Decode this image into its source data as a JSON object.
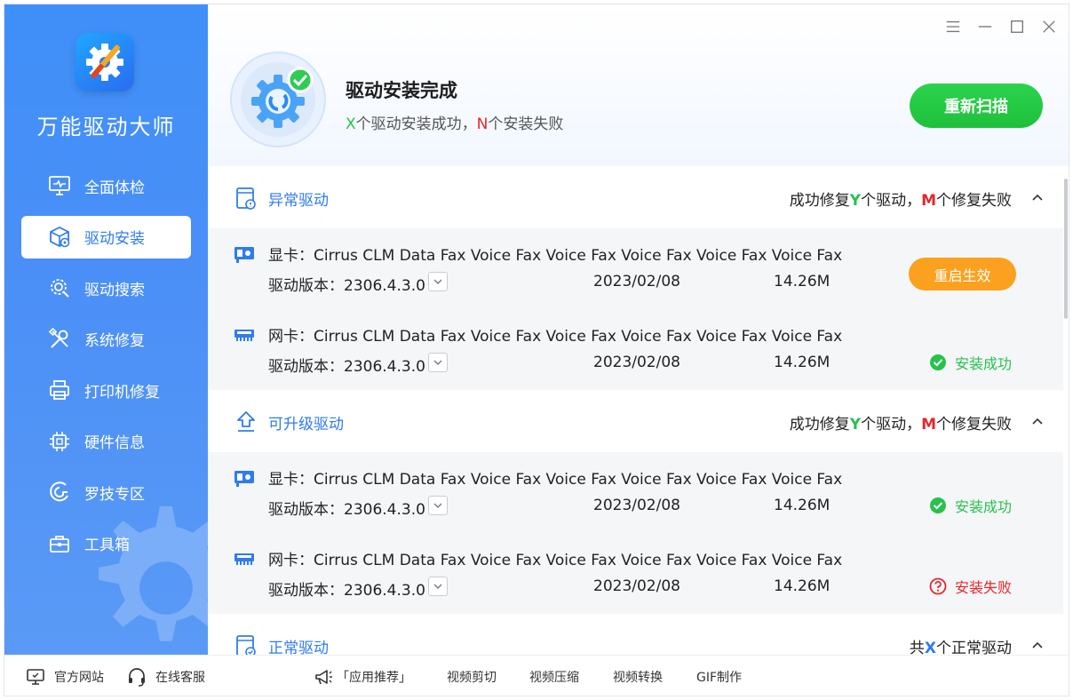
{
  "app": {
    "title": "万能驱动大师"
  },
  "sidebar": {
    "items": [
      {
        "label": "全面体检",
        "icon": "monitor-pulse-icon",
        "active": false
      },
      {
        "label": "驱动安装",
        "icon": "box-gear-icon",
        "active": true
      },
      {
        "label": "驱动搜索",
        "icon": "gear-search-icon",
        "active": false
      },
      {
        "label": "系统修复",
        "icon": "wrench-screwdriver-icon",
        "active": false
      },
      {
        "label": "打印机修复",
        "icon": "printer-icon",
        "active": false
      },
      {
        "label": "硬件信息",
        "icon": "chip-icon",
        "active": false
      },
      {
        "label": "罗技专区",
        "icon": "logitech-icon",
        "active": false
      },
      {
        "label": "工具箱",
        "icon": "toolbox-icon",
        "active": false
      }
    ]
  },
  "header": {
    "title": "驱动安装完成",
    "subtitle": {
      "x": "X",
      "part1": "个驱动安装成功，",
      "n": "N",
      "part2": "个安装失败"
    },
    "rescan_label": "重新扫描"
  },
  "sections": [
    {
      "title": "异常驱动",
      "summary": {
        "part1": "成功修复",
        "y": "Y",
        "part2": "个驱动，",
        "m": "M",
        "part3": "个修复失败"
      },
      "rows": [
        {
          "name": "显卡：Cirrus CLM Data Fax Voice Fax Voice Fax Voice Fax Voice Fax Voice Fax ...",
          "icon": "display-card-icon",
          "version": "驱动版本：2306.4.3.0",
          "date": "2023/02/08",
          "size": "14.26M",
          "status_type": "restart",
          "status_label": "重启生效"
        },
        {
          "name": "网卡：Cirrus CLM Data Fax Voice Fax Voice Fax Voice Fax Voice Fax Voice Fax ...",
          "icon": "network-card-icon",
          "version": "驱动版本：2306.4.3.0",
          "date": "2023/02/08",
          "size": "14.26M",
          "status_type": "ok",
          "status_label": "安装成功"
        }
      ]
    },
    {
      "title": "可升级驱动",
      "summary": {
        "part1": "成功修复",
        "y": "Y",
        "part2": "个驱动，",
        "m": "M",
        "part3": "个修复失败"
      },
      "rows": [
        {
          "name": "显卡：Cirrus CLM Data Fax Voice Fax Voice Fax Voice Fax Voice Fax Voice Fax ...",
          "icon": "display-card-icon",
          "version": "驱动版本：2306.4.3.0",
          "date": "2023/02/08",
          "size": "14.26M",
          "status_type": "ok",
          "status_label": "安装成功"
        },
        {
          "name": "网卡：Cirrus CLM Data Fax Voice Fax Voice Fax Voice Fax Voice Fax Voice Fax ...",
          "icon": "network-card-icon",
          "version": "驱动版本：2306.4.3.0",
          "date": "2023/02/08",
          "size": "14.26M",
          "status_type": "fail",
          "status_label": "安装失败"
        }
      ]
    },
    {
      "title": "正常驱动",
      "summary": {
        "part1": "共",
        "x": "X",
        "part2": "个正常驱动"
      }
    }
  ],
  "footer": {
    "website": "官方网站",
    "service": "在线客服",
    "recommend": "「应用推荐」",
    "links": [
      "视频剪切",
      "视频压缩",
      "视频转换",
      "GIF制作"
    ]
  },
  "colors": {
    "primary": "#2f7bf0",
    "green": "#27c24c",
    "red": "#e6272a",
    "orange": "#fba11f",
    "sidebar": "#4a8ff7"
  }
}
